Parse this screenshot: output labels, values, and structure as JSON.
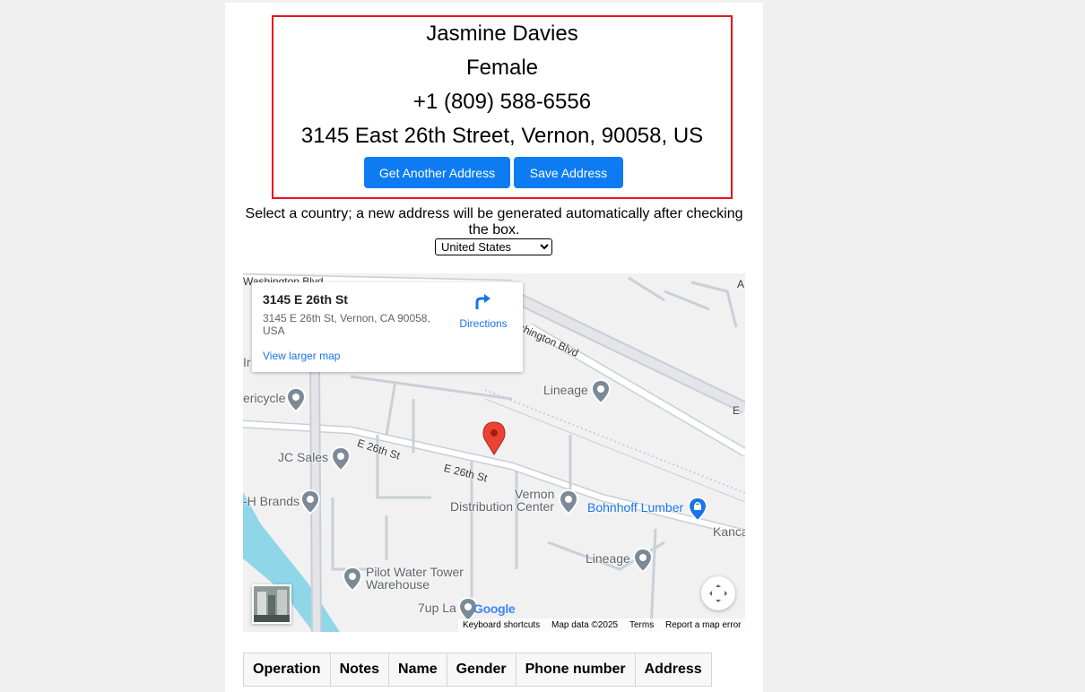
{
  "profile": {
    "name": "Jasmine Davies",
    "gender": "Female",
    "phone": "+1 (809) 588-6556",
    "address": "3145 East 26th Street, Vernon, 90058, US"
  },
  "actions": {
    "get_another": "Get Another Address",
    "save": "Save Address"
  },
  "instructions": "Select a country; a new address will be generated automatically after checking the box.",
  "country_select": {
    "selected": "United States"
  },
  "map": {
    "info_card": {
      "title": "3145 E 26th St",
      "address": "3145 E 26th St, Vernon, CA 90058, USA",
      "directions_label": "Directions",
      "larger_map_link": "View larger map"
    },
    "roads": {
      "washington_top": "Washington Blvd",
      "washington_diag": "ashington Blvd",
      "e26_a": "E 26th St",
      "e26_b": "E 26th St",
      "edge_e": "E",
      "edge_a": "A"
    },
    "places": {
      "lineage_top": "Lineage",
      "pericycle": "ericycle",
      "jc_sales": "JC Sales",
      "h_brands": "-H Brands",
      "vernon_dc_1": "Vernon",
      "vernon_dc_2": "Distribution Center",
      "bohnhoff": "Bohnhoff Lumber",
      "kanca": "Kanca",
      "lineage_bottom": "Lineage",
      "pilot_1": "Pilot Water Tower",
      "pilot_2": "Warehouse",
      "seven_up": "7up La",
      "ir": "Ir"
    },
    "logo": "Google",
    "attribution": {
      "shortcuts": "Keyboard shortcuts",
      "map_data": "Map data ©2025",
      "terms": "Terms",
      "report": "Report a map error"
    },
    "colors": {
      "background": "#f1f1f2",
      "road": "#ffffff",
      "road_outline": "#c9ced6",
      "water": "#8fd6e8",
      "marker": "#ea4335",
      "poi": "#7b8a96",
      "poi_shopping": "#1a73e8"
    }
  },
  "table": {
    "headers": [
      "Operation",
      "Notes",
      "Name",
      "Gender",
      "Phone number",
      "Address"
    ]
  },
  "colors": {
    "button": "#0d7cf2",
    "card_border": "#e8141b"
  }
}
